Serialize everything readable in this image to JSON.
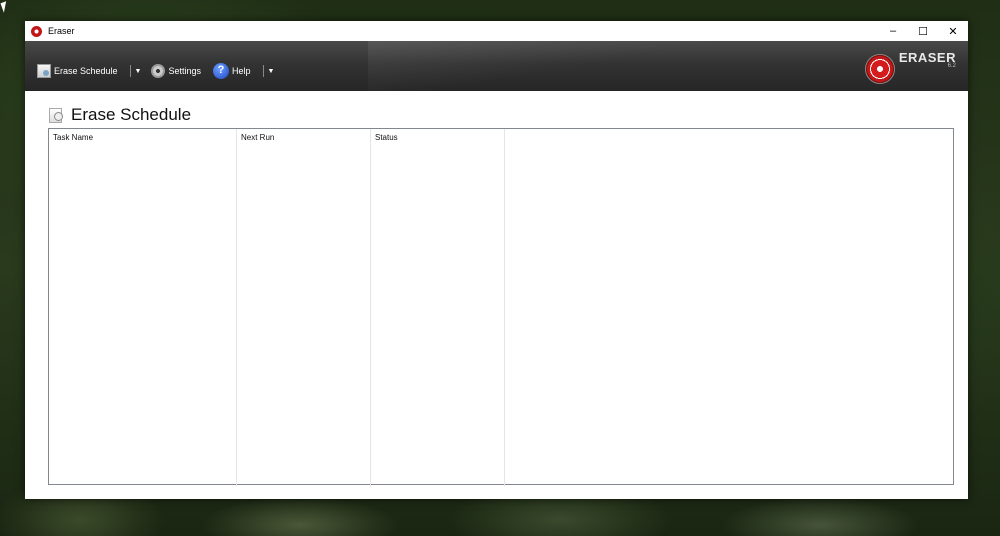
{
  "window": {
    "title": "Eraser",
    "controls": {
      "minimize": "–",
      "maximize": "☐",
      "close": "✕"
    }
  },
  "toolbar": {
    "erase_schedule_label": "Erase Schedule",
    "settings_label": "Settings",
    "help_label": "Help",
    "help_glyph": "?",
    "dropdown_glyph": "▼"
  },
  "brand": {
    "name": "ERASER",
    "version": "6.2"
  },
  "page": {
    "title": "Erase Schedule"
  },
  "table": {
    "columns": [
      "Task Name",
      "Next Run",
      "Status",
      ""
    ],
    "rows": []
  }
}
